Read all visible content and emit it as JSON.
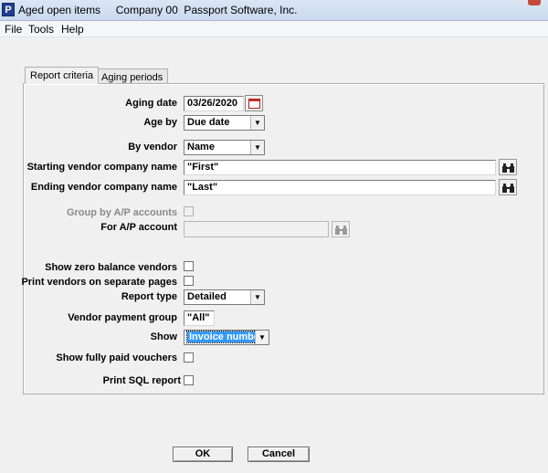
{
  "window": {
    "title": "Aged open items     Company 00  Passport Software, Inc.",
    "app_icon_letter": "P"
  },
  "menu": [
    "File",
    "Tools",
    "Help"
  ],
  "tabs": [
    {
      "label": "Report criteria",
      "active": true
    },
    {
      "label": "Aging periods",
      "active": false
    }
  ],
  "form": {
    "aging_date_label": "Aging date",
    "aging_date_value": "03/26/2020",
    "age_by_label": "Age by",
    "age_by_value": "Due date",
    "by_vendor_label": "By vendor",
    "by_vendor_value": "Name",
    "starting_vendor_label": "Starting vendor company name",
    "starting_vendor_value": "\"First\"",
    "ending_vendor_label": "Ending vendor company name",
    "ending_vendor_value": "\"Last\"",
    "group_by_ap_label": "Group by A/P accounts",
    "for_ap_account_label": "For A/P account",
    "for_ap_account_value": "",
    "show_zero_label": "Show zero balance vendors",
    "print_separate_label": "Print vendors on separate pages",
    "report_type_label": "Report type",
    "report_type_value": "Detailed",
    "vendor_payment_group_label": "Vendor payment group",
    "vendor_payment_group_value": "\"All\"",
    "show_label": "Show",
    "show_value": "Invoice number",
    "show_fully_paid_label": "Show fully paid vouchers",
    "print_sql_label": "Print SQL report"
  },
  "buttons": {
    "ok": "OK",
    "cancel": "Cancel"
  },
  "colors": {
    "selection": "#3399ff",
    "window_bg": "#f0f0f0"
  }
}
